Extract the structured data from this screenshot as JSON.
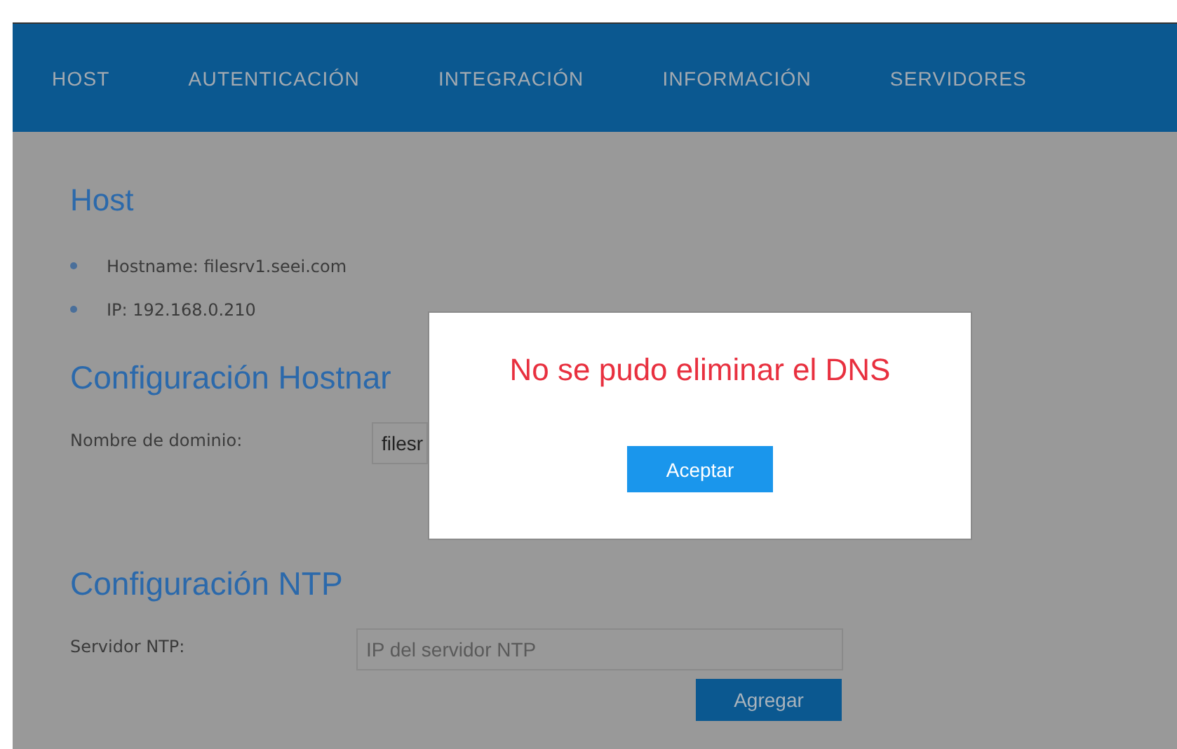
{
  "nav": {
    "items": [
      {
        "label": "HOST"
      },
      {
        "label": "AUTENTICACIÓN"
      },
      {
        "label": "INTEGRACIÓN"
      },
      {
        "label": "INFORMACIÓN"
      },
      {
        "label": "SERVIDORES"
      }
    ]
  },
  "sections": [
    {
      "kind": "info",
      "title": "Host",
      "items": [
        "Hostname: filesrv1.seei.com",
        "IP: 192.168.0.210"
      ]
    },
    {
      "kind": "form",
      "title": "Configuración Hostnar",
      "fields": [
        {
          "label": "Nombre de dominio:",
          "value": "filesr"
        }
      ]
    },
    {
      "kind": "form",
      "title": "Configuración NTP",
      "fields": [
        {
          "label": "Servidor NTP:",
          "placeholder": "IP del servidor NTP"
        }
      ],
      "button": "Agregar"
    }
  ],
  "dialog": {
    "message": "No se pudo eliminar el DNS",
    "button": "Aceptar"
  }
}
